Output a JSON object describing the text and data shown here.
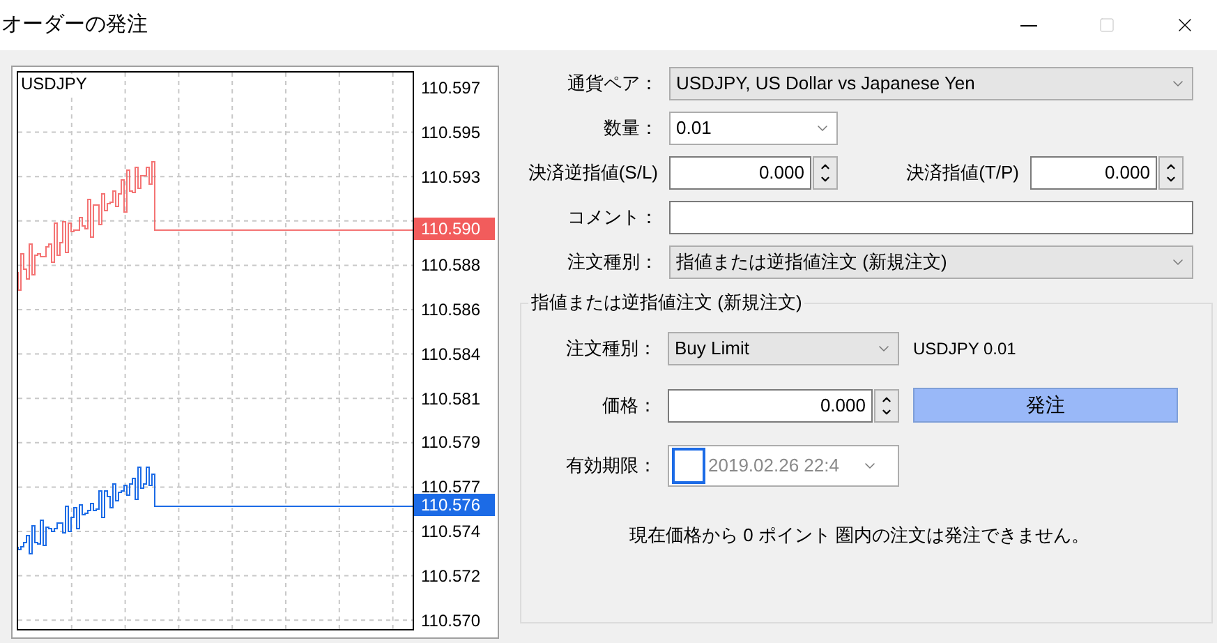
{
  "window": {
    "title": "オーダーの発注"
  },
  "chart": {
    "symbol": "USDJPY",
    "y_labels": [
      "110.597",
      "110.595",
      "110.593",
      "110.588",
      "110.586",
      "110.584",
      "110.581",
      "110.579",
      "110.577",
      "110.574",
      "110.572",
      "110.570"
    ],
    "bid_tag": {
      "label": "110.590",
      "color": "#f25c5c"
    },
    "ask_tag": {
      "label": "110.576",
      "color": "#1c6be6"
    }
  },
  "symbol_field": {
    "label": "通貨ペア：",
    "value": "USDJPY, US Dollar vs Japanese Yen"
  },
  "volume_field": {
    "label": "数量：",
    "value": "0.01"
  },
  "stop_loss": {
    "label": "決済逆指値(S/L)",
    "value": "0.000"
  },
  "take_profit": {
    "label": "決済指値(T/P)",
    "value": "0.000"
  },
  "comment_field": {
    "label": "コメント："
  },
  "order_type_field": {
    "label": "注文種別：",
    "value": "指値または逆指値注文 (新規注文)"
  },
  "pending_group": {
    "title": "指値または逆指値注文 (新規注文)",
    "type_field": {
      "label": "注文種別：",
      "value": "Buy Limit"
    },
    "summary": "USDJPY 0.01",
    "price_field": {
      "label": "価格：",
      "value": "0.000"
    },
    "place_button": "発注",
    "expiry_field": {
      "label": "有効期限：",
      "checked": false,
      "value": "2019.02.26 22:4"
    },
    "notice": "現在価格から 0 ポイント 圏内の注文は発注できません。"
  }
}
